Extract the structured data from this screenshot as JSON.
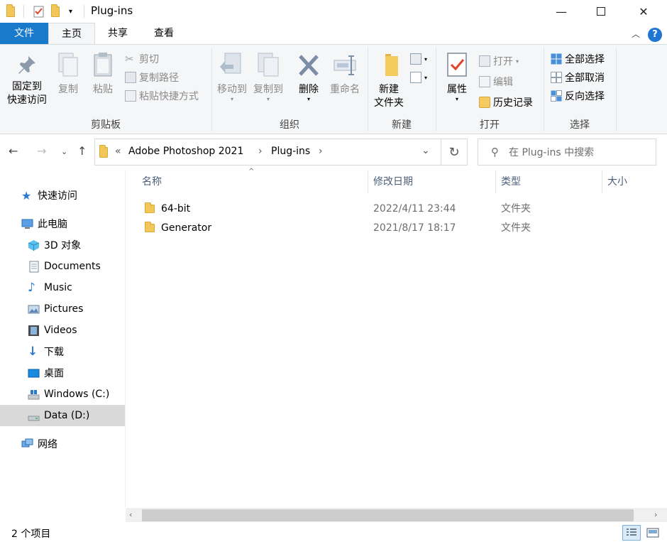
{
  "window": {
    "title": "Plug-ins",
    "minimize": "—",
    "maximize": "☐",
    "close": "✕"
  },
  "ribbon_tabs": {
    "file": "文件",
    "home": "主页",
    "share": "共享",
    "view": "查看"
  },
  "ribbon": {
    "clipboard": {
      "group": "剪贴板",
      "pin_line1": "固定到",
      "pin_line2": "快速访问",
      "copy": "复制",
      "paste": "粘贴",
      "cut": "剪切",
      "copy_path": "复制路径",
      "paste_shortcut": "粘贴快捷方式"
    },
    "organize": {
      "group": "组织",
      "move_to": "移动到",
      "copy_to": "复制到",
      "delete": "删除",
      "rename": "重命名"
    },
    "new": {
      "group": "新建",
      "new_folder_line1": "新建",
      "new_folder_line2": "文件夹"
    },
    "open": {
      "group": "打开",
      "properties": "属性",
      "open": "打开",
      "edit": "编辑",
      "history": "历史记录"
    },
    "select": {
      "group": "选择",
      "select_all": "全部选择",
      "select_none": "全部取消",
      "invert": "反向选择"
    }
  },
  "address": {
    "prefix": "«",
    "crumbs": [
      "Adobe Photoshop 2021",
      "Plug-ins"
    ],
    "sep": "›"
  },
  "search": {
    "placeholder": "在 Plug-ins 中搜索"
  },
  "nav": {
    "quick_access": "快速访问",
    "this_pc": "此电脑",
    "items": [
      "3D 对象",
      "Documents",
      "Music",
      "Pictures",
      "Videos",
      "下载",
      "桌面",
      "Windows (C:)",
      "Data (D:)"
    ],
    "network": "网络",
    "selected": "Data (D:)"
  },
  "columns": {
    "name": "名称",
    "modified": "修改日期",
    "type": "类型",
    "size": "大小"
  },
  "files": [
    {
      "name": "64-bit",
      "modified": "2022/4/11 23:44",
      "type": "文件夹"
    },
    {
      "name": "Generator",
      "modified": "2021/8/17 18:17",
      "type": "文件夹"
    }
  ],
  "status": {
    "count": "2 个项目"
  },
  "colors": {
    "file_tab": "#1979ca",
    "ribbon_bg": "#f5f6f7",
    "selected_nav": "#d9d9d9",
    "folder": "#f1c75a",
    "help": "#1e76d2"
  }
}
